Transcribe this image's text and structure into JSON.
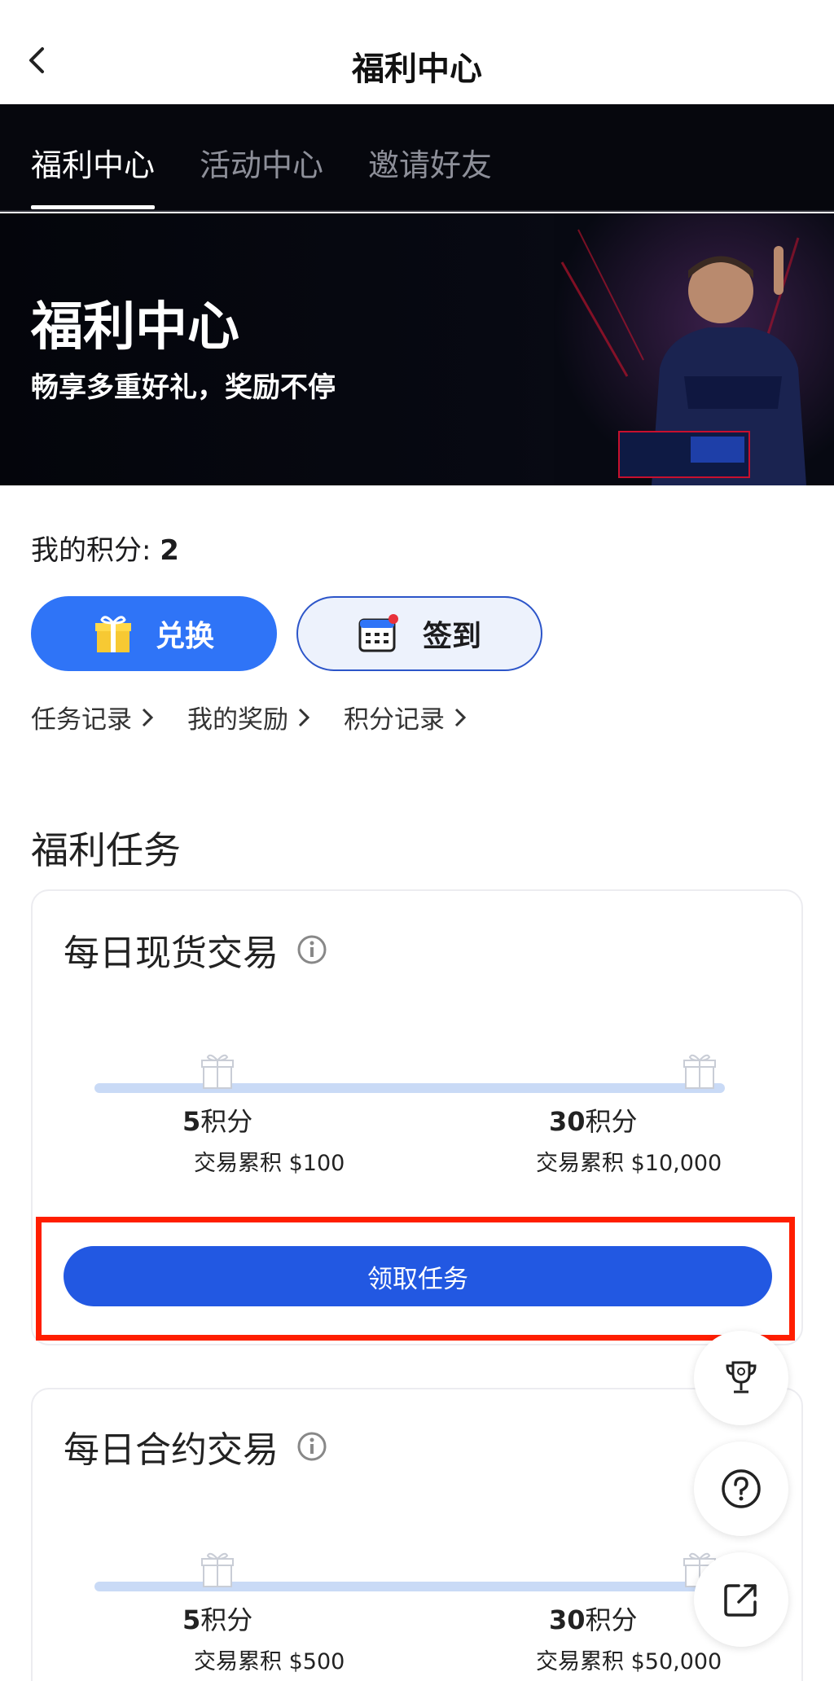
{
  "header": {
    "title": "福利中心"
  },
  "tabs": [
    {
      "label": "福利中心",
      "active": true
    },
    {
      "label": "活动中心",
      "active": false
    },
    {
      "label": "邀请好友",
      "active": false
    }
  ],
  "banner": {
    "title": "福利中心",
    "subtitle": "畅享多重好礼，奖励不停"
  },
  "points": {
    "label": "我的积分:",
    "value": "2"
  },
  "actions": {
    "redeem_label": "兑换",
    "checkin_label": "签到"
  },
  "links": [
    "任务记录",
    "我的奖励",
    "积分记录"
  ],
  "section": {
    "title": "福利任务"
  },
  "tasks": [
    {
      "title": "每日现货交易",
      "tiers": [
        {
          "points": "5",
          "unit": "积分",
          "desc": "交易累积 $100"
        },
        {
          "points": "30",
          "unit": "积分",
          "desc": "交易累积 $10,000"
        }
      ],
      "button_label": "领取任务"
    },
    {
      "title": "每日合约交易",
      "tiers": [
        {
          "points": "5",
          "unit": "积分",
          "desc": "交易累积 $500"
        },
        {
          "points": "30",
          "unit": "积分",
          "desc": "交易累积 $50,000"
        }
      ]
    }
  ],
  "floating": [
    "trophy-icon",
    "help-icon",
    "share-icon"
  ],
  "colors": {
    "primary": "#2f74f7",
    "claim": "#2258e2",
    "highlight": "#ff1e00",
    "banner": "#06070d"
  }
}
